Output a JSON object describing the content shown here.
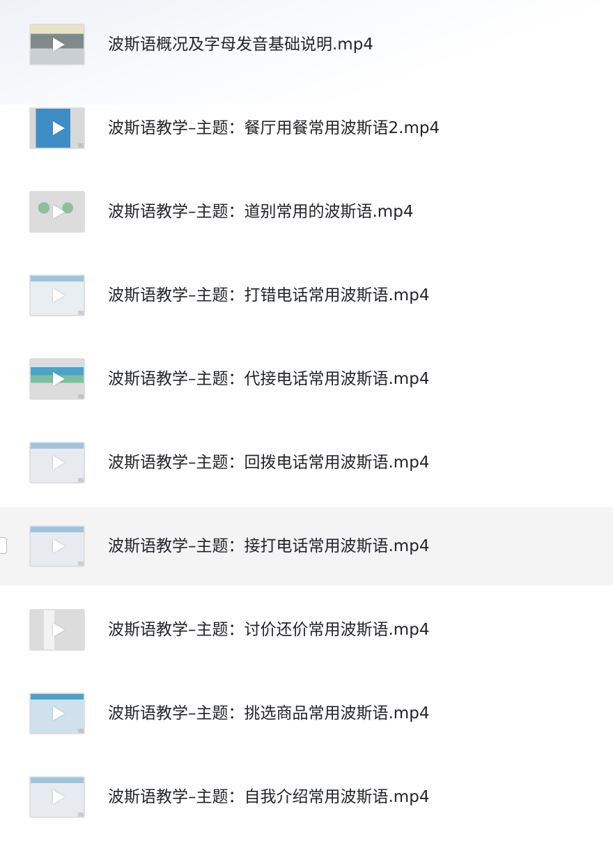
{
  "files": [
    {
      "name": "波斯语概况及字母发音基础说明.mp4",
      "thumb": "video-thumbnail",
      "hovered": false
    },
    {
      "name": "波斯语教学–主题：餐厅用餐常用波斯语2.mp4",
      "thumb": "video-thumbnail",
      "hovered": false
    },
    {
      "name": "波斯语教学–主题：道别常用的波斯语.mp4",
      "thumb": "video-thumbnail",
      "hovered": false
    },
    {
      "name": "波斯语教学–主题：打错电话常用波斯语.mp4",
      "thumb": "video-thumbnail",
      "hovered": false
    },
    {
      "name": "波斯语教学–主题：代接电话常用波斯语.mp4",
      "thumb": "video-thumbnail",
      "hovered": false
    },
    {
      "name": "波斯语教学–主题：回拨电话常用波斯语.mp4",
      "thumb": "video-thumbnail",
      "hovered": false
    },
    {
      "name": "波斯语教学–主题：接打电话常用波斯语.mp4",
      "thumb": "video-thumbnail",
      "hovered": true
    },
    {
      "name": "波斯语教学–主题：讨价还价常用波斯语.mp4",
      "thumb": "video-thumbnail",
      "hovered": false
    },
    {
      "name": "波斯语教学–主题：挑选商品常用波斯语.mp4",
      "thumb": "video-thumbnail",
      "hovered": false
    },
    {
      "name": "波斯语教学–主题：自我介绍常用波斯语.mp4",
      "thumb": "video-thumbnail",
      "hovered": false
    }
  ],
  "colors": {
    "row_hover": "#f4f4f5",
    "text": "#222429",
    "play_icon": "#ffffff"
  }
}
